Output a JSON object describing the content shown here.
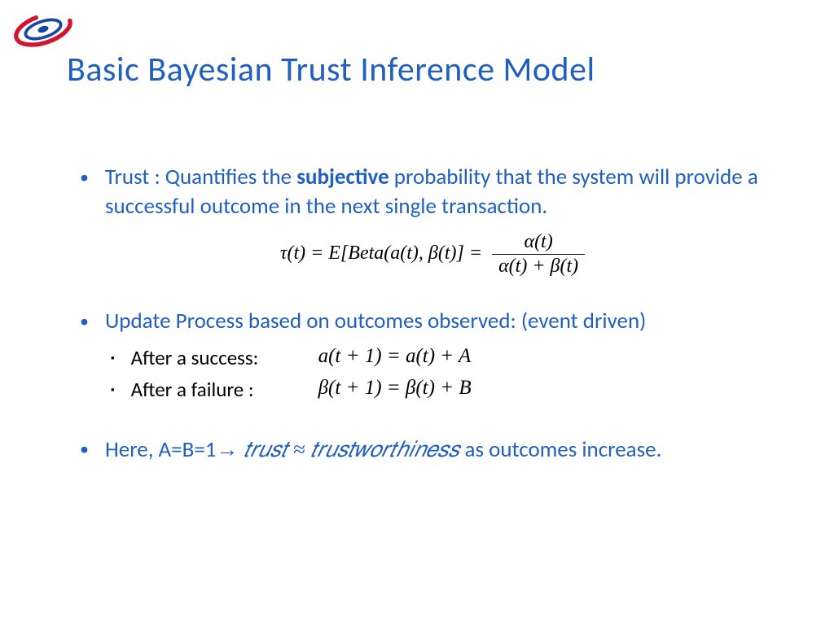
{
  "title": "Basic Bayesian Trust Inference Model",
  "bullet1": {
    "pre": "Trust : Quantifies the ",
    "bold": "subjective",
    "post": " probability that the system will provide a successful outcome in the next single transaction."
  },
  "formula1": {
    "lhs": "τ(t) = E[Beta(a(t), β(t)] = ",
    "num": "α(t)",
    "den": "α(t) + β(t)"
  },
  "bullet2": "Update Process based on outcomes observed: (event driven)",
  "sub": {
    "success_label": "After a success:",
    "success_math": "a(t + 1) = a(t) + A",
    "failure_label": "After a failure  :",
    "failure_math": "β(t + 1) = β(t) + B"
  },
  "bullet3": {
    "pre": "Here,  A=B=1",
    "arrow": "→",
    "math": " 𝑡𝑟𝑢𝑠𝑡 ≈ 𝑡𝑟𝑢𝑠𝑡𝑤𝑜𝑟𝑡ℎ𝑖𝑛𝑒𝑠𝑠 ",
    "post": "as outcomes increase."
  }
}
